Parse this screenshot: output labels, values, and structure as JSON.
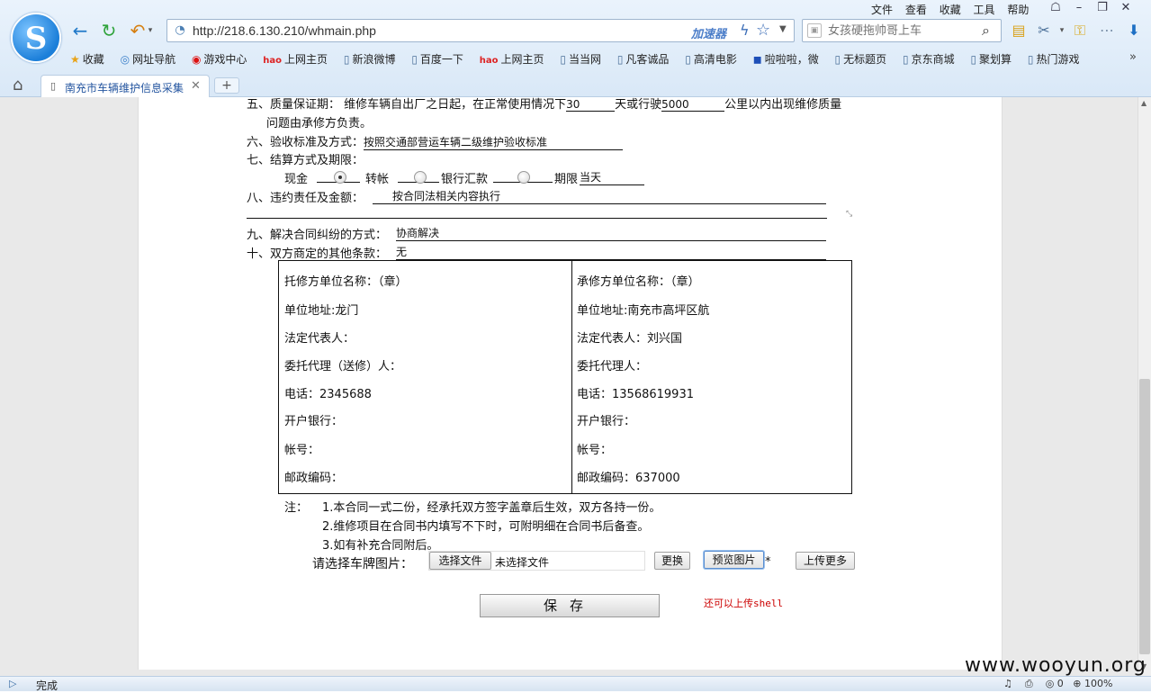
{
  "browser": {
    "menu": [
      "文件",
      "查看",
      "收藏",
      "工具",
      "帮助"
    ],
    "url": "http://218.6.130.210/whmain.php",
    "accelerator": "加速器",
    "search_placeholder": "女孩硬拖帅哥上车",
    "bookmarks": [
      {
        "icon": "★",
        "label": "收藏"
      },
      {
        "icon": "◎",
        "label": "网址导航"
      },
      {
        "icon": "◉",
        "label": "游戏中心"
      },
      {
        "icon": "hao",
        "label": "上网主页"
      },
      {
        "icon": "▯",
        "label": "新浪微博"
      },
      {
        "icon": "▯",
        "label": "百度一下"
      },
      {
        "icon": "hao",
        "label": "上网主页"
      },
      {
        "icon": "▯",
        "label": "当当网"
      },
      {
        "icon": "▯",
        "label": "凡客诚品"
      },
      {
        "icon": "▯",
        "label": "高清电影"
      },
      {
        "icon": "◼",
        "label": "啦啦啦，微"
      },
      {
        "icon": "▯",
        "label": "无标题页"
      },
      {
        "icon": "▯",
        "label": "京东商城"
      },
      {
        "icon": "▯",
        "label": "聚划算"
      },
      {
        "icon": "▯",
        "label": "热门游戏"
      }
    ],
    "tab_title": "南充市车辆维护信息采集",
    "status_text": "完成",
    "status_count": "0",
    "zoom": "100%"
  },
  "contract": {
    "s5_a": "五、质量保证期：  维修车辆自出厂之日起，在正常使用情况下",
    "s5_days": "30",
    "s5_b": "天或行驶",
    "s5_km": "5000",
    "s5_c": "公里以内出现维修质量",
    "s5_line2": "问题由承修方负责。",
    "s6_label": "六、验收标准及方式：",
    "s6_value": "按照交通部营运车辆二级维护验收标准",
    "s7_label": "七、结算方式及期限：",
    "pay_cash": "现金",
    "pay_transfer": "转帐",
    "pay_bank": "银行汇款",
    "pay_term": "期限",
    "pay_term_value": "当天",
    "s8_label": "八、违约责任及金额：",
    "s8_value": "按合同法相关内容执行",
    "s9_label": "九、解决合同纠纷的方式：",
    "s9_value": "协商解决",
    "s10_label": "十、双方商定的其他条款：",
    "s10_value": "无"
  },
  "sign_left": {
    "name": "托修方单位名称：（章）",
    "address": "单位地址:龙门",
    "legal": "法定代表人：",
    "agent": "委托代理（送修）人：",
    "phone": "电话：2345688",
    "bank": "开户银行：",
    "account": "帐号：",
    "postcode": "邮政编码："
  },
  "sign_right": {
    "name": "承修方单位名称：（章）",
    "address": "单位地址:南充市高坪区航",
    "legal": "法定代表人：刘兴国",
    "agent": "委托代理人：",
    "phone": "电话：13568619931",
    "bank": "开户银行：",
    "account": "帐号：",
    "postcode": "邮政编码：637000"
  },
  "notes": {
    "label": "注：",
    "n1": "1.本合同一式二份，经承托双方签字盖章后生效，双方各持一份。",
    "n2": "2.维修项目在合同书内填写不下时，可附明细在合同书后备查。",
    "n3": "3.如有补充合同附后。"
  },
  "upload": {
    "label": "请选择车牌图片：",
    "choose": "选择文件",
    "no_file": "未选择文件",
    "replace": "更换",
    "preview": "预览图片",
    "star": "*",
    "more": "上传更多"
  },
  "save_label": "保存",
  "shell_note": "还可以上传shell",
  "watermark": "www.wooyun.org"
}
